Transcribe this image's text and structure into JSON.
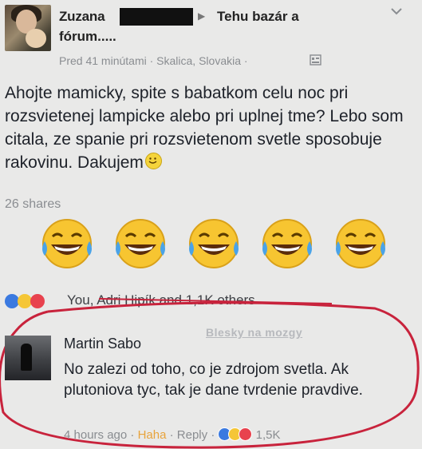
{
  "post": {
    "author": "Zuzana",
    "group_name_line1": "Tehu bazár a",
    "group_name_line2": "fórum.....",
    "time": "Pred 41 minútami",
    "location": "Skalica, Slovakia",
    "body": "Ahojte mamicky, spite s babatkom celu noc pri rozsvietenej lampicke alebo pri uplnej tme? Lebo som citala, ze spanie pri rozsvietenom svetle sposobuje rakovinu. Dakujem",
    "shares": "26 shares",
    "likers": "You, Adri Hipík and 1,1K others"
  },
  "watermark": "Blesky na mozgy",
  "comment": {
    "author": "Martin Sabo",
    "text": "No zalezi od toho, co je zdrojom svetla. Ak plutoniova tyc, tak je dane tvrdenie pravdive.",
    "time": "4 hours ago",
    "haha_label": "Haha",
    "reply_label": "Reply",
    "reaction_count": "1,5K"
  },
  "colors": {
    "background": "#e9e9e8",
    "secondary_text": "#8a8d91",
    "haha_accent": "#e8a33b",
    "highlight_red": "#c8233c"
  }
}
